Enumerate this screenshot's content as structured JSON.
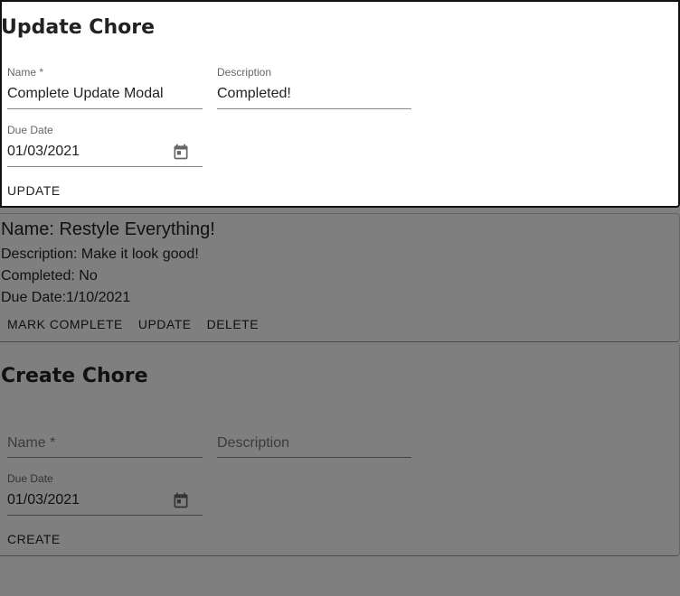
{
  "chore": {
    "name_line": "Name: Restyle Everything!",
    "description_line": "Description: Make it look good!",
    "completed_line": "Completed: No",
    "due_line": "Due Date:1/10/2021",
    "actions": {
      "mark_complete": "MARK COMPLETE",
      "update": "UPDATE",
      "delete": "DELETE"
    }
  },
  "create_form": {
    "title": "Create Chore",
    "name_placeholder": "Name *",
    "description_placeholder": "Description",
    "due_label": "Due Date",
    "due_value": "01/03/2021",
    "submit": "CREATE"
  },
  "update_modal": {
    "title": "Update Chore",
    "name_label": "Name *",
    "name_value": "Complete Update Modal",
    "description_label": "Description",
    "description_value": "Completed!",
    "due_label": "Due Date",
    "due_value": "01/03/2021",
    "submit": "UPDATE"
  },
  "icons": {
    "calendar": "calendar-icon"
  },
  "colors": {
    "backdrop": "#000000",
    "text": "#222222",
    "label": "#666666"
  }
}
